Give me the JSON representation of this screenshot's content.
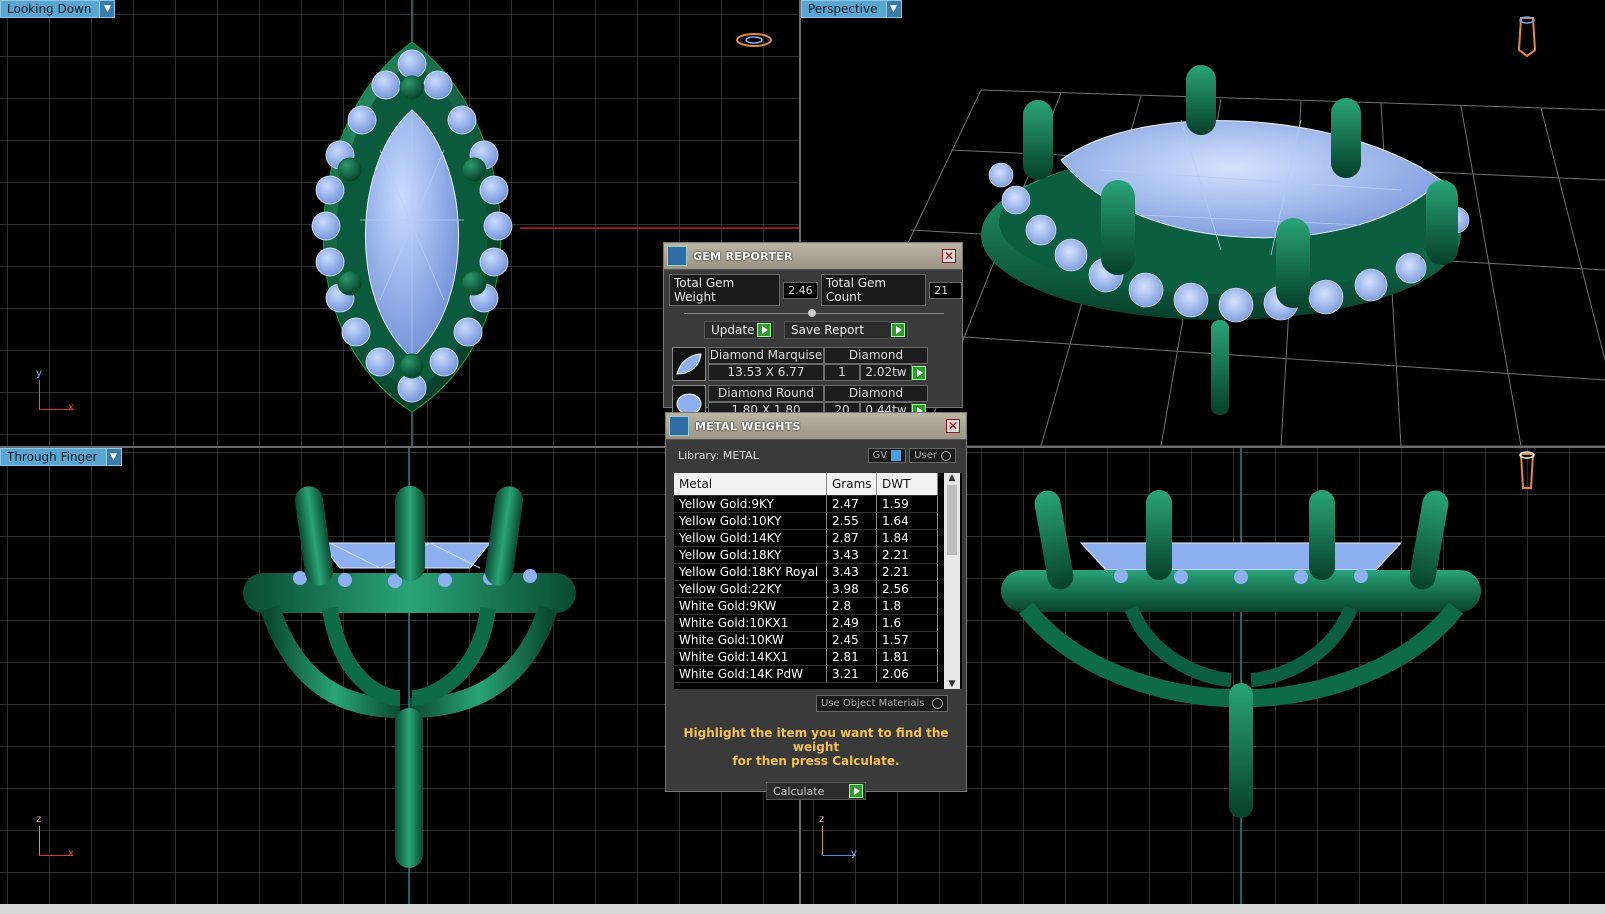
{
  "viewports": {
    "top_left": {
      "label": "Looking Down",
      "axis_a": "y",
      "axis_b": "x"
    },
    "top_right": {
      "label": "Perspective"
    },
    "bottom_left": {
      "label": "Through Finger",
      "axis_a": "z",
      "axis_b": "x"
    },
    "bottom_right": {
      "axis_a": "z",
      "axis_b": "y"
    }
  },
  "gem_reporter": {
    "title": "GEM REPORTER",
    "total_weight_label": "Total Gem Weight",
    "total_weight_value": "2.46",
    "total_count_label": "Total Gem Count",
    "total_count_value": "21",
    "update_label": "Update",
    "save_report_label": "Save Report",
    "gems": [
      {
        "name": "Diamond Marquise",
        "material": "Diamond",
        "size": "13.53 X 6.77",
        "count": "1",
        "weight": "2.02tw"
      },
      {
        "name": "Diamond Round",
        "material": "Diamond",
        "size": "1.80 X 1.80",
        "count": "20",
        "weight": "0.44tw"
      }
    ]
  },
  "metal_weights": {
    "title": "METAL WEIGHTS",
    "library_label": "Library: METAL",
    "gv_label": "GV",
    "user_label": "User",
    "columns": [
      "Metal",
      "Grams",
      "DWT"
    ],
    "rows": [
      {
        "metal": "Yellow Gold:9KY",
        "grams": "2.47",
        "dwt": "1.59"
      },
      {
        "metal": "Yellow Gold:10KY",
        "grams": "2.55",
        "dwt": "1.64"
      },
      {
        "metal": "Yellow Gold:14KY",
        "grams": "2.87",
        "dwt": "1.84"
      },
      {
        "metal": "Yellow Gold:18KY",
        "grams": "3.43",
        "dwt": "2.21"
      },
      {
        "metal": "Yellow Gold:18KY Royal",
        "grams": "3.43",
        "dwt": "2.21"
      },
      {
        "metal": "Yellow Gold:22KY",
        "grams": "3.98",
        "dwt": "2.56"
      },
      {
        "metal": "White Gold:9KW",
        "grams": "2.8",
        "dwt": "1.8"
      },
      {
        "metal": "White Gold:10KX1",
        "grams": "2.49",
        "dwt": "1.6"
      },
      {
        "metal": "White Gold:10KW",
        "grams": "2.45",
        "dwt": "1.57"
      },
      {
        "metal": "White Gold:14KX1",
        "grams": "2.81",
        "dwt": "1.81"
      },
      {
        "metal": "White Gold:14K PdW",
        "grams": "3.21",
        "dwt": "2.06"
      }
    ],
    "use_object_materials_label": "Use Object Materials",
    "hint_line1": "Highlight the item you want to find the weight",
    "hint_line2": "for then press Calculate.",
    "calculate_label": "Calculate"
  },
  "colors": {
    "metal": "#0e6b4a",
    "gem": "#8fb0f0",
    "grid": "#5a5a5a",
    "viewport_label_bg": "#5aa6d2",
    "hint_text": "#f2c14e"
  }
}
